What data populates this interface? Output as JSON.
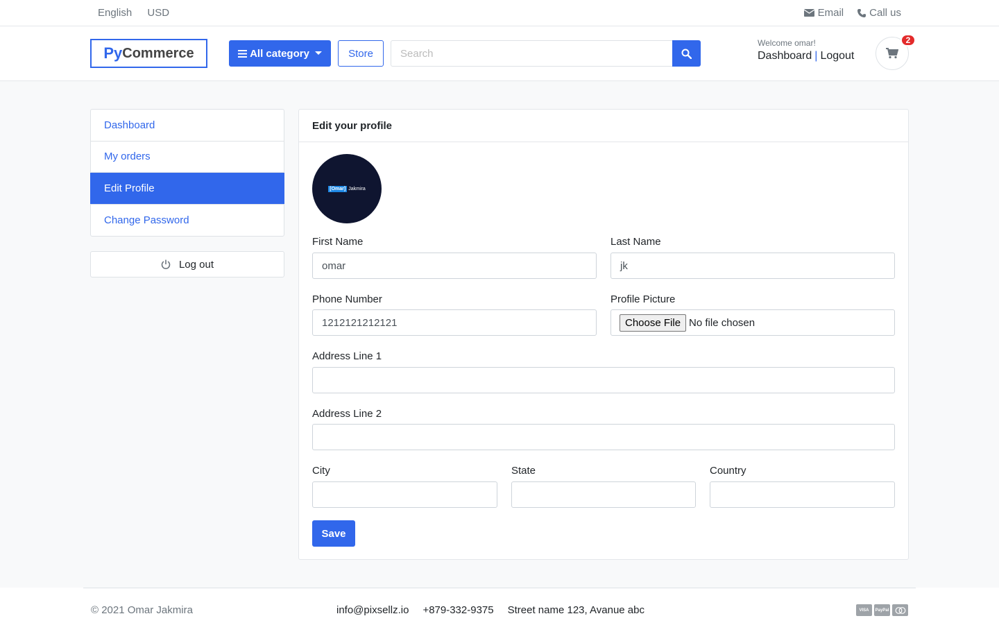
{
  "topbar": {
    "language": "English",
    "currency": "USD",
    "email": "Email",
    "call": "Call us"
  },
  "header": {
    "logo_py": "Py",
    "logo_commerce": "Commerce",
    "category_button": "All category",
    "store_button": "Store",
    "search_placeholder": "Search",
    "welcome": "Welcome omar!",
    "dashboard_link": "Dashboard",
    "separator": "|",
    "logout_link": "Logout",
    "cart_count": "2"
  },
  "sidebar": {
    "items": [
      {
        "label": "Dashboard"
      },
      {
        "label": "My orders"
      },
      {
        "label": "Edit Profile"
      },
      {
        "label": "Change Password"
      }
    ],
    "logout": "Log out"
  },
  "profile": {
    "title": "Edit your profile",
    "avatar_highlight": "[Omar]",
    "avatar_name": "Jakmira",
    "first_name_label": "First Name",
    "first_name_value": "omar",
    "last_name_label": "Last Name",
    "last_name_value": "jk",
    "phone_label": "Phone Number",
    "phone_value": "1212121212121",
    "picture_label": "Profile Picture",
    "choose_file": "Choose File",
    "no_file": "No file chosen",
    "address1_label": "Address Line 1",
    "address1_value": "",
    "address2_label": "Address Line 2",
    "address2_value": "",
    "city_label": "City",
    "state_label": "State",
    "country_label": "Country",
    "save": "Save"
  },
  "footer": {
    "copyright": "© 2021 Omar Jakmira",
    "email": "info@pixsellz.io",
    "phone": "+879-332-9375",
    "address": "Street name 123, Avanue abc",
    "payments": [
      "VISA",
      "PayPal",
      "MC"
    ]
  },
  "colors": {
    "primary": "#3167eb",
    "badge": "#e32b2b",
    "avatar_bg": "#0f1530"
  }
}
